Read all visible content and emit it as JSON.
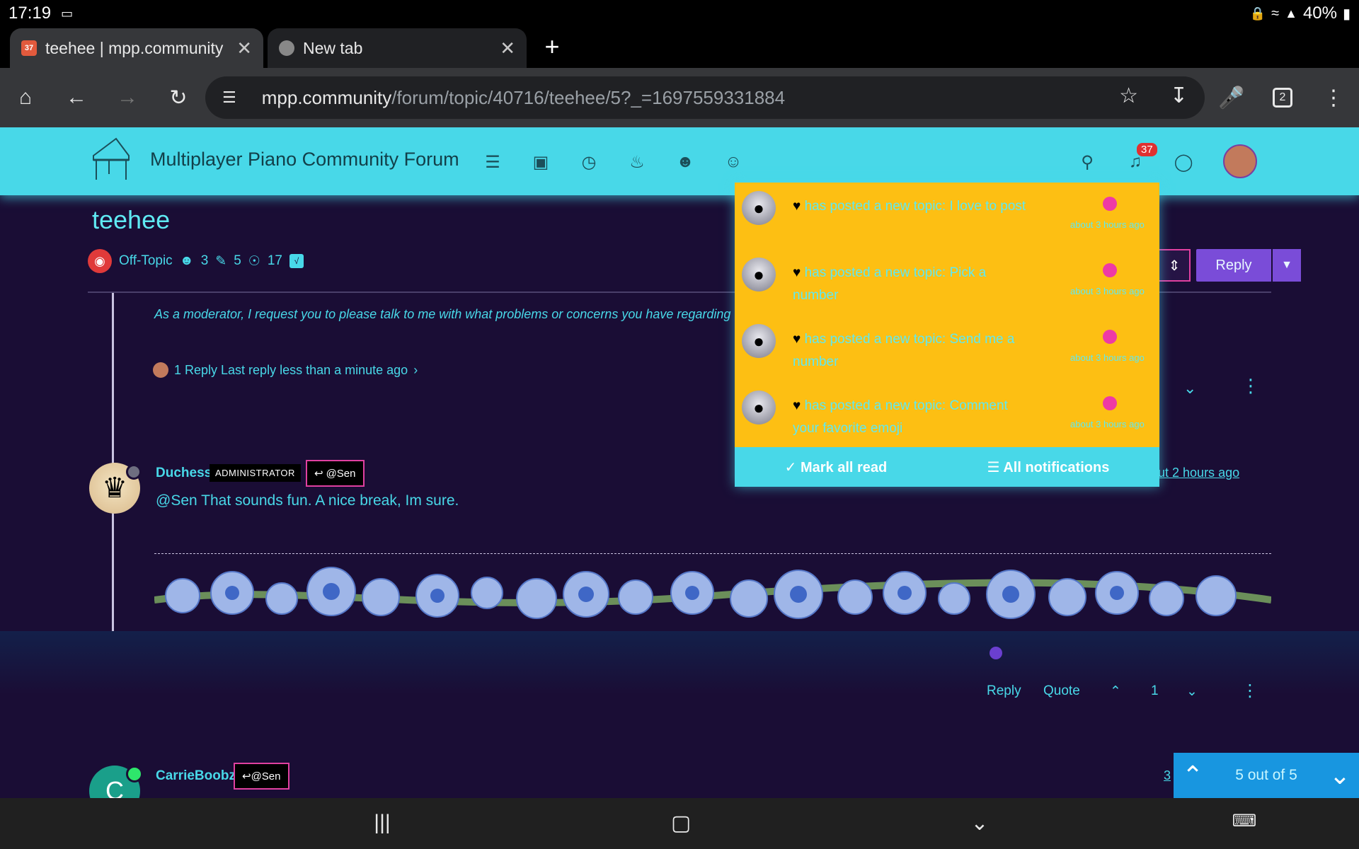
{
  "status_bar": {
    "time": "17:19",
    "battery": "40%"
  },
  "tabs": [
    {
      "favicon_badge": "37",
      "title": "teehee | mpp.community",
      "active": true
    },
    {
      "title": "New tab",
      "active": false
    }
  ],
  "address_bar": {
    "domain": "mpp.community",
    "path": "/forum/topic/40716/teehee/5?_=1697559331884",
    "tab_count": "2"
  },
  "forum": {
    "title": "Multiplayer Piano Community Forum",
    "notification_count": "37"
  },
  "topic": {
    "title": "teehee",
    "category": "Off-Topic",
    "posters": "3",
    "posts": "5",
    "views": "17",
    "reply_label": "Reply"
  },
  "previous_post": {
    "text": "As a moderator, I request you to please talk to me with what problems or concerns you have regarding this",
    "reply_summary": "1 Reply Last reply less than a minute ago"
  },
  "post": {
    "author": "Duchess",
    "badge": "ADMINISTRATOR",
    "reply_to": "@Sen",
    "time": "out 2 hours ago",
    "body": "@Sen That sounds fun. A nice break, Im sure.",
    "actions": {
      "reply": "Reply",
      "quote": "Quote",
      "votes": "1"
    }
  },
  "next_post": {
    "author": "CarrieBoobz",
    "reply_to": "@Sen",
    "time": "3"
  },
  "pager": {
    "label": "5 out of 5"
  },
  "notifications": {
    "items": [
      {
        "text": "has posted a new topic: I love to post",
        "time": "about 3 hours ago"
      },
      {
        "text": "has posted a new topic: Pick a number",
        "time": "about 3 hours ago"
      },
      {
        "text": "has posted a new topic: Send me a number",
        "time": "about 3 hours ago"
      },
      {
        "text": "has posted a new topic: Comment your favorite emoji",
        "time": "about 3 hours ago"
      }
    ],
    "mark_all_read": "Mark all read",
    "all_notifications": "All notifications"
  }
}
